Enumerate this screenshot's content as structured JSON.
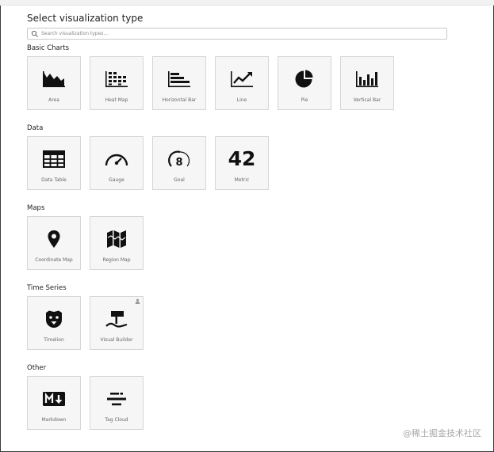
{
  "dialog": {
    "title": "Select visualization type",
    "search": {
      "placeholder": "Search visualization types..."
    }
  },
  "sections": [
    {
      "title": "Basic Charts",
      "items": [
        {
          "label": "Area",
          "icon": "area-chart-icon"
        },
        {
          "label": "Heat Map",
          "icon": "heat-map-icon"
        },
        {
          "label": "Horizontal Bar",
          "icon": "horizontal-bar-icon"
        },
        {
          "label": "Line",
          "icon": "line-chart-icon"
        },
        {
          "label": "Pie",
          "icon": "pie-chart-icon"
        },
        {
          "label": "Vertical Bar",
          "icon": "vertical-bar-icon"
        }
      ]
    },
    {
      "title": "Data",
      "items": [
        {
          "label": "Data Table",
          "icon": "table-icon"
        },
        {
          "label": "Gauge",
          "icon": "gauge-icon"
        },
        {
          "label": "Goal",
          "icon": "goal-icon",
          "glyph": "8"
        },
        {
          "label": "Metric",
          "icon": "metric-icon",
          "glyph": "42"
        }
      ]
    },
    {
      "title": "Maps",
      "items": [
        {
          "label": "Coordinate Map",
          "icon": "map-pin-icon"
        },
        {
          "label": "Region Map",
          "icon": "region-map-icon"
        }
      ]
    },
    {
      "title": "Time Series",
      "items": [
        {
          "label": "Timelion",
          "icon": "timelion-icon"
        },
        {
          "label": "Visual Builder",
          "icon": "visual-builder-icon",
          "badge": "experimental-icon"
        }
      ]
    },
    {
      "title": "Other",
      "items": [
        {
          "label": "Markdown",
          "icon": "markdown-icon"
        },
        {
          "label": "Tag Cloud",
          "icon": "tag-cloud-icon"
        }
      ]
    }
  ],
  "watermark": "@稀土掘金技术社区",
  "colors": {
    "icon": "#111111",
    "card_bg": "#f6f6f6",
    "card_border": "#d6d6d6",
    "label": "#666666"
  }
}
